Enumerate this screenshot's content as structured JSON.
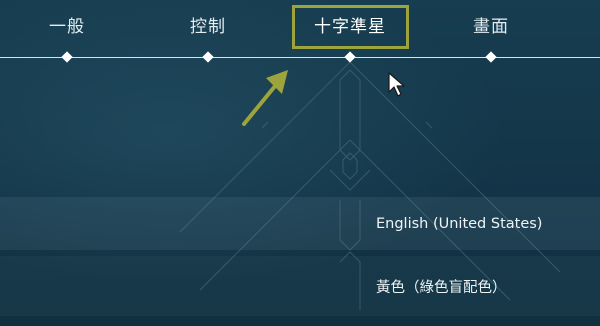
{
  "tabs": [
    {
      "label": "一般",
      "active": false
    },
    {
      "label": "控制",
      "active": false
    },
    {
      "label": "十字準星",
      "active": true
    },
    {
      "label": "畫面",
      "active": false
    }
  ],
  "settings": {
    "language_value": "English (United States)",
    "color_value": "黃色（綠色盲配色）"
  },
  "colors": {
    "background": "#15384a",
    "highlight": "#9ea43c",
    "text": "#e4edf0"
  },
  "icons": [
    "pointer-cursor-icon",
    "annotation-arrow-icon"
  ]
}
